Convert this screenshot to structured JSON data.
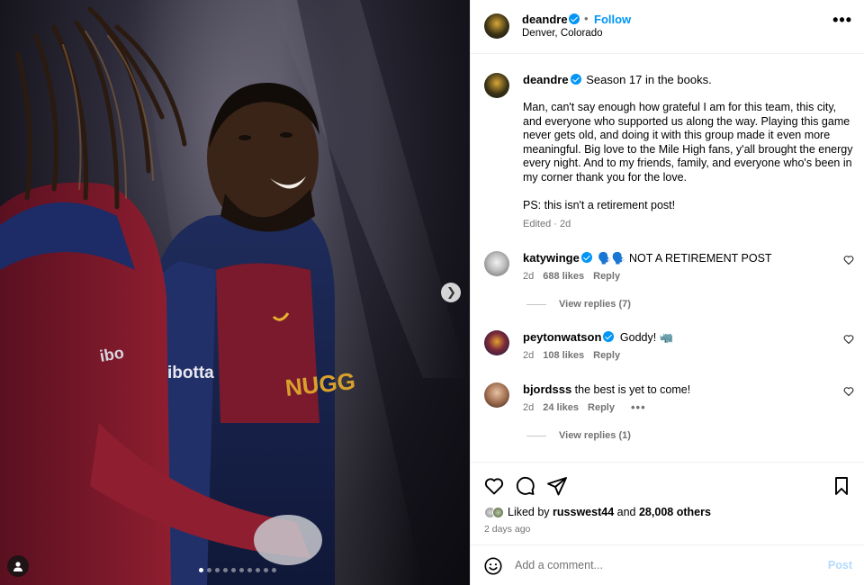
{
  "post": {
    "author": "deandre",
    "follow_label": "Follow",
    "bullet": "•",
    "location": "Denver, Colorado",
    "more_label": "•••"
  },
  "media": {
    "jersey_patch": "ibotta",
    "jersey_text": "NUGGETS",
    "next_icon": "chevron-right-icon",
    "dot_count": 10,
    "active_dot": 0
  },
  "caption": {
    "username": "deandre",
    "headline": "Season 17 in the books.",
    "paragraph1": "Man, can't say enough how grateful I am for this team, this city, and everyone who supported us along the way. Playing this game never gets old, and doing it with this group made it even more meaningful. Big love to the Mile High fans, y'all brought the energy every night. And to my friends, family, and everyone who's been in my corner thank you for the love.",
    "paragraph2": "PS: this isn't a retirement post!",
    "meta": "Edited · 2d"
  },
  "comments": [
    {
      "username": "katywinge",
      "verified": true,
      "text": "🗣️🗣️ NOT A RETIREMENT POST",
      "age": "2d",
      "likes": "688 likes",
      "reply": "Reply",
      "view_replies": "View replies (7)"
    },
    {
      "username": "peytonwatson",
      "verified": true,
      "text": "Goddy! 🦏",
      "age": "2d",
      "likes": "108 likes",
      "reply": "Reply"
    },
    {
      "username": "bjordsss",
      "verified": false,
      "text": "the best is yet to come!",
      "age": "2d",
      "likes": "24 likes",
      "reply": "Reply",
      "more": "•••",
      "view_replies": "View replies (1)"
    }
  ],
  "actions": {
    "liked_by_prefix": "Liked by",
    "liked_by_user": "russwest44",
    "liked_by_and": "and",
    "liked_by_others": "28,008 others",
    "posted_ago": "2 days ago"
  },
  "comment_bar": {
    "placeholder": "Add a comment...",
    "post_label": "Post"
  },
  "colors": {
    "accent": "#0095f6",
    "muted": "#737373",
    "post_disabled": "#b3dbff"
  }
}
